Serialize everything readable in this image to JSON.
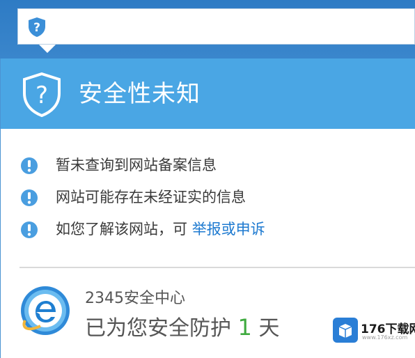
{
  "address_bar": {
    "security_icon": "shield-question-icon"
  },
  "banner": {
    "icon": "shield-question-icon",
    "title": "安全性未知",
    "color": "#4aa6e4"
  },
  "info_items": [
    {
      "icon": "info-icon",
      "text": "暂未查询到网站备案信息"
    },
    {
      "icon": "info-icon",
      "text": "网站可能存在未经证实的信息"
    },
    {
      "icon": "info-icon",
      "text": "如您了解该网站，可 ",
      "link": "举报或申诉"
    }
  ],
  "footer": {
    "logo": "ie-browser-logo",
    "title": "2345安全中心",
    "status_prefix": "已为您安全防护 ",
    "days": "1",
    "status_suffix": " 天"
  },
  "watermark": {
    "name": "176下载网",
    "url": "www.176xz.com"
  },
  "colors": {
    "accent": "#4aa6e4",
    "link": "#1e7ad0",
    "days": "#3faa3f"
  }
}
